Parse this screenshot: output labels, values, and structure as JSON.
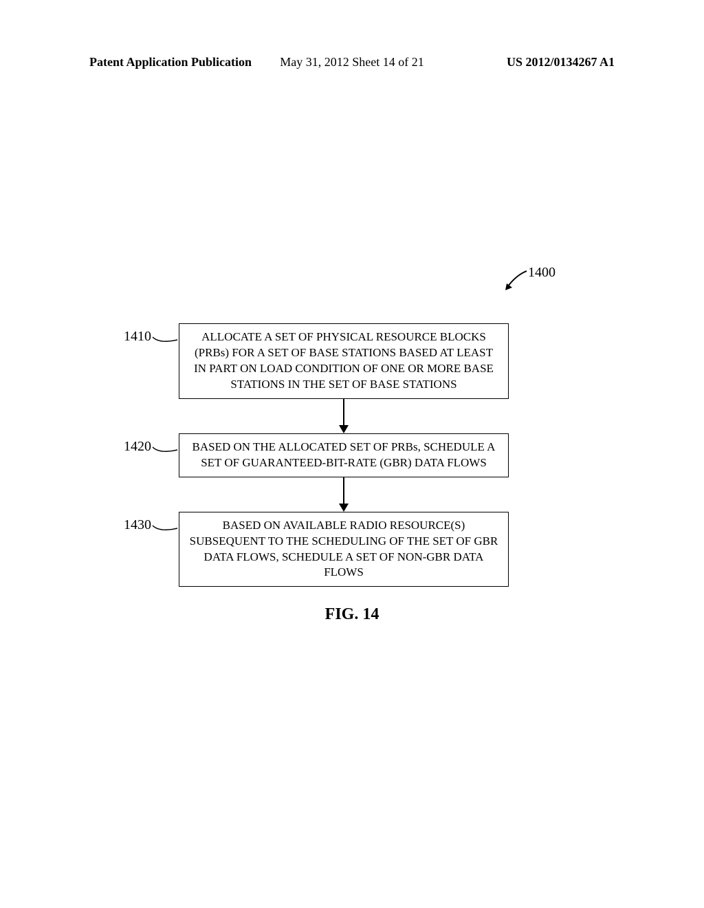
{
  "header": {
    "left": "Patent Application Publication",
    "center": "May 31, 2012  Sheet 14 of 21",
    "right": "US 2012/0134267 A1"
  },
  "diagram": {
    "refNumber": "1400",
    "steps": [
      {
        "id": "1410",
        "text": "ALLOCATE A SET OF PHYSICAL RESOURCE BLOCKS (PRBs) FOR A SET OF BASE STATIONS BASED AT LEAST IN PART ON LOAD CONDITION OF ONE OR MORE BASE STATIONS IN THE SET OF BASE STATIONS"
      },
      {
        "id": "1420",
        "text": "BASED ON THE ALLOCATED SET OF PRBs, SCHEDULE A SET OF GUARANTEED-BIT-RATE (GBR) DATA FLOWS"
      },
      {
        "id": "1430",
        "text": "BASED ON AVAILABLE RADIO RESOURCE(S) SUBSEQUENT TO THE SCHEDULING OF THE SET OF GBR DATA FLOWS, SCHEDULE A SET OF NON-GBR DATA FLOWS"
      }
    ]
  },
  "figureLabel": "FIG. 14"
}
